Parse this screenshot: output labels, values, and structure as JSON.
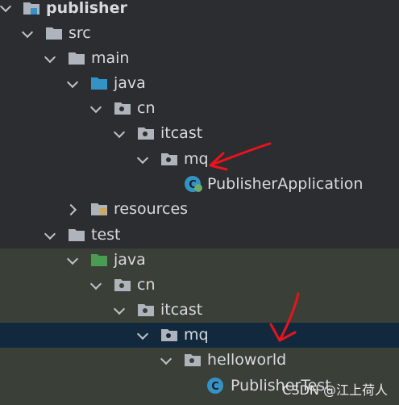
{
  "tree": {
    "project": "publisher",
    "src": "src",
    "main": "main",
    "main_java": "java",
    "main_cn": "cn",
    "main_itcast": "itcast",
    "main_mq": "mq",
    "main_class": "PublisherApplication",
    "resources": "resources",
    "test": "test",
    "test_java": "java",
    "test_cn": "cn",
    "test_itcast": "itcast",
    "test_mq": "mq",
    "helloworld": "helloworld",
    "test_class": "PublisherTest"
  },
  "colors": {
    "background": "#2b2d30",
    "test_section_background": "#3a3f38",
    "selected_row": "#12293d",
    "annotation_arrow": "#e8141c",
    "source_folder": "#3592c4",
    "test_folder": "#499c54",
    "folder": "#aeb3bc"
  },
  "icons": {
    "folder": "folder-icon",
    "package": "package-icon",
    "class": "java-class-icon",
    "resources": "resources-folder-icon",
    "module": "module-icon"
  },
  "watermark": "CSDN @江上荷人"
}
